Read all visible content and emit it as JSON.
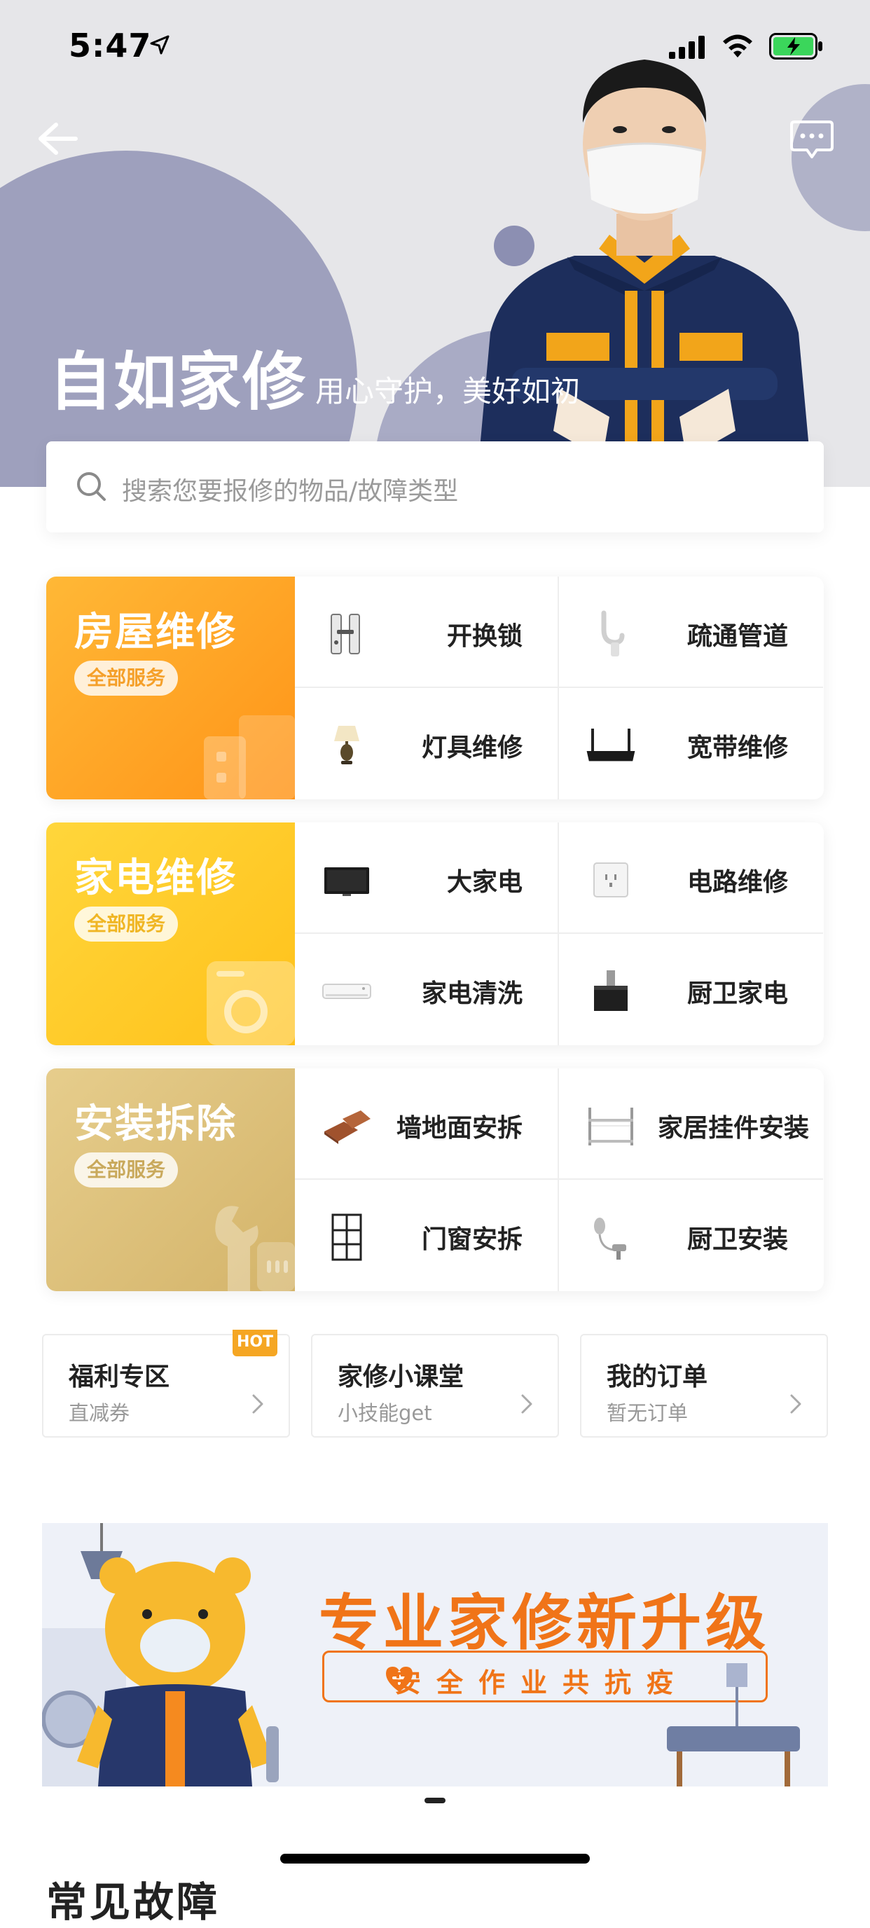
{
  "status_bar": {
    "time": "5:47"
  },
  "hero": {
    "title": "自如家修",
    "subtitle": "用心守护，美好如初"
  },
  "search": {
    "placeholder": "搜索您要报修的物品/故障类型"
  },
  "categories": [
    {
      "title": "房屋维修",
      "pill": "全部服务",
      "colors": {
        "from": "#ffb836",
        "to": "#ff9418",
        "pill_text": "#f5a02a"
      },
      "items": [
        {
          "label": "开换锁",
          "icon": "door-lock-icon"
        },
        {
          "label": "疏通管道",
          "icon": "drain-pipe-icon"
        },
        {
          "label": "灯具维修",
          "icon": "table-lamp-icon"
        },
        {
          "label": "宽带维修",
          "icon": "router-icon"
        }
      ]
    },
    {
      "title": "家电维修",
      "pill": "全部服务",
      "colors": {
        "from": "#ffd63b",
        "to": "#ffc11a",
        "pill_text": "#f0b624"
      },
      "items": [
        {
          "label": "大家电",
          "icon": "television-icon"
        },
        {
          "label": "电路维修",
          "icon": "power-outlet-icon"
        },
        {
          "label": "家电清洗",
          "icon": "air-conditioner-icon"
        },
        {
          "label": "厨卫家电",
          "icon": "range-hood-icon"
        }
      ]
    },
    {
      "title": "安装拆除",
      "pill": "全部服务",
      "colors": {
        "from": "#e6cd8c",
        "to": "#d4b46a",
        "pill_text": "#c9a95c"
      },
      "items": [
        {
          "label": "墙地面安拆",
          "icon": "floor-tile-icon"
        },
        {
          "label": "家居挂件安装",
          "icon": "wall-shelf-icon"
        },
        {
          "label": "门窗安拆",
          "icon": "window-frame-icon"
        },
        {
          "label": "厨卫安装",
          "icon": "shower-head-icon"
        }
      ]
    }
  ],
  "quick_links": [
    {
      "title": "福利专区",
      "sub": "直减券",
      "badge": "HOT"
    },
    {
      "title": "家修小课堂",
      "sub": "小技能get"
    },
    {
      "title": "我的订单",
      "sub": "暂无订单"
    }
  ],
  "banner": {
    "title": "专业家修新升级",
    "sub": "安全作业共抗疫"
  },
  "next_section": {
    "title": "常见故障"
  },
  "colors": {
    "accent_orange": "#f07418",
    "hot_badge": "#f5a623",
    "hero_bg": "#e6e6e9"
  }
}
